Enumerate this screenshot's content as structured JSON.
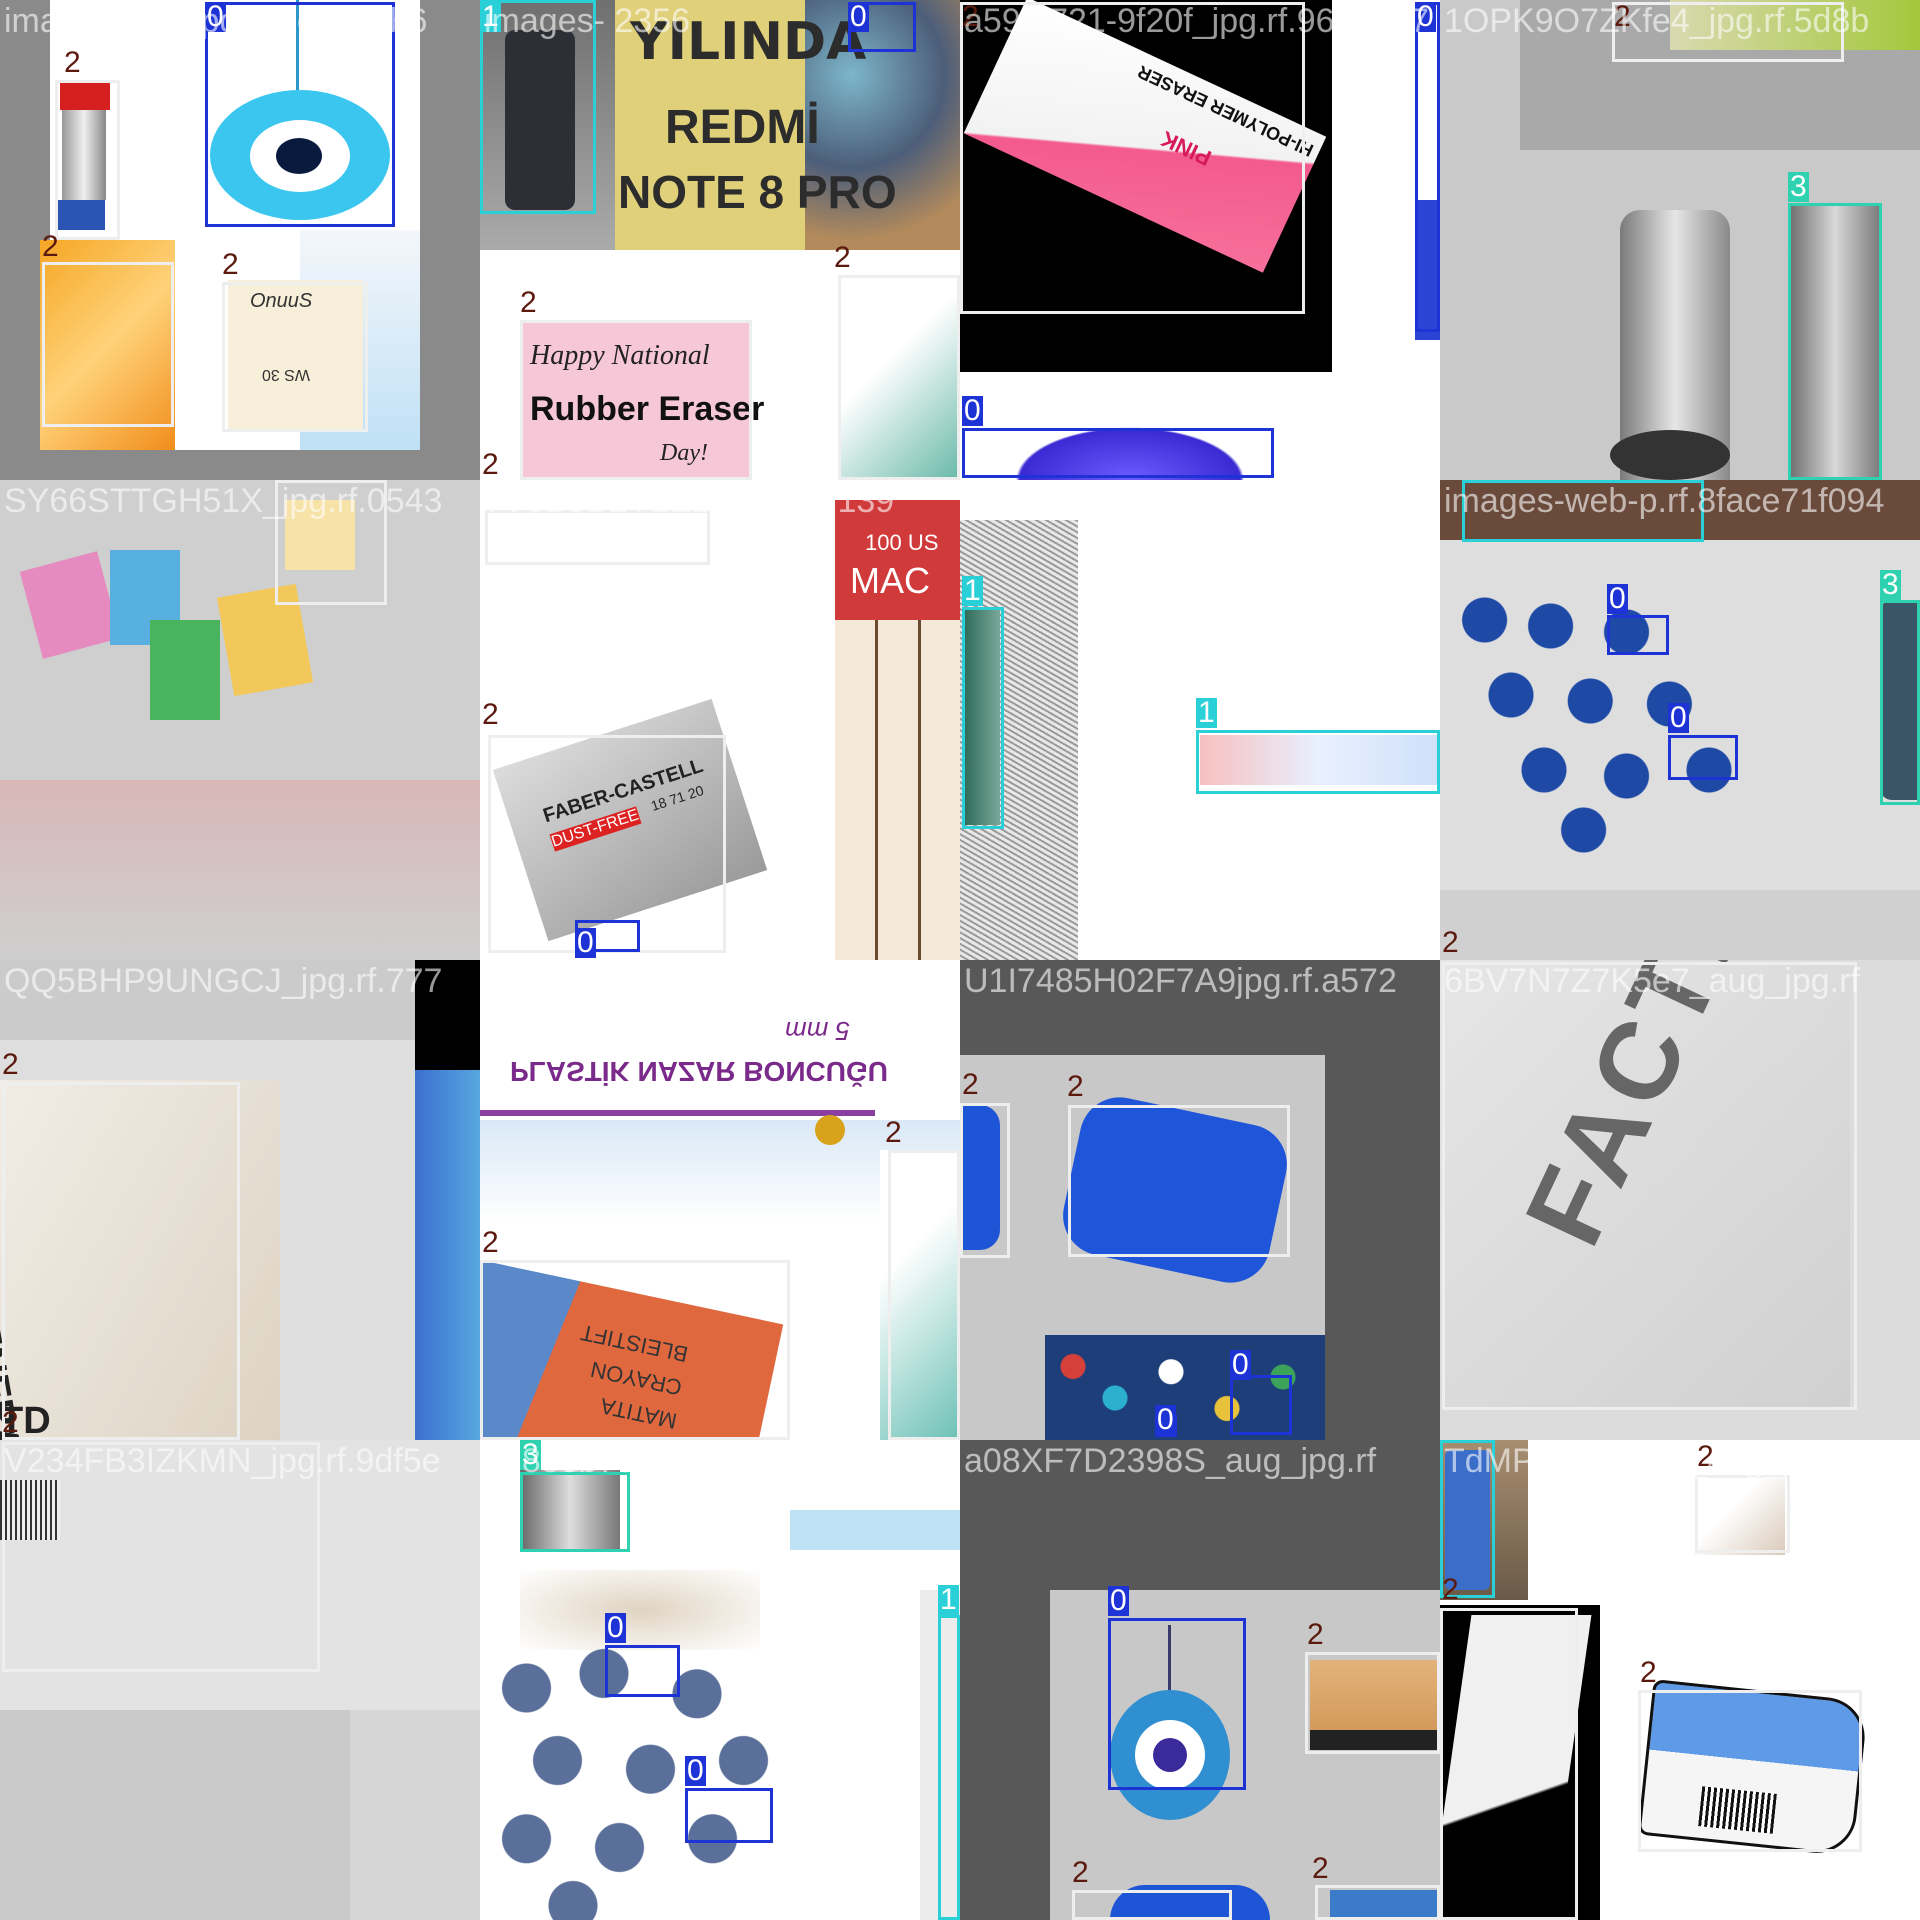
{
  "grid": {
    "tiles": [
      {
        "filename": "images-13-_jpg.rf.6ceb44b6",
        "boxes": [
          {
            "cls": "0",
            "label": "0"
          },
          {
            "cls": "2",
            "label": "2"
          },
          {
            "cls": "2",
            "label": "2"
          },
          {
            "cls": "2",
            "label": "2"
          }
        ],
        "texts": [
          "OnuuS",
          "WS 30"
        ]
      },
      {
        "filename": "images-  2356",
        "boxes": [
          {
            "cls": "1",
            "label": "1"
          },
          {
            "cls": "0",
            "label": "0"
          },
          {
            "cls": "2",
            "label": "2"
          },
          {
            "cls": "2",
            "label": "2"
          },
          {
            "cls": "2",
            "label": "2"
          }
        ],
        "texts": [
          "YILINDA",
          "REDMİ",
          "NOTE 8 PRO",
          "Happy National",
          "Rubber Eraser",
          "Day!"
        ]
      },
      {
        "filename": "a59 1721-9f20f_jpg.rf.96a0987",
        "boxes": [
          {
            "cls": "2",
            "label": "2"
          },
          {
            "cls": "0",
            "label": "0"
          },
          {
            "cls": "0",
            "label": "0"
          }
        ],
        "texts": [
          "PINK",
          "HI-POLYMER ERASER"
        ]
      },
      {
        "filename": "1OPK9O7ZKfe4_jpg.rf.5d8b",
        "boxes": [
          {
            "cls": "2",
            "label": "2"
          },
          {
            "cls": "3",
            "label": "3"
          }
        ],
        "texts": []
      },
      {
        "filename": "SY66STTGH51X_jpg.rf.0543",
        "boxes": [
          {
            "cls": "2",
            "label": "2"
          },
          {
            "cls": "2",
            "label": "2"
          }
        ],
        "texts": []
      },
      {
        "filename": "7V5B3B2Y1EB1_jpg.rf.139",
        "boxes": [
          {
            "cls": "2",
            "label": "2"
          },
          {
            "cls": "0",
            "label": "0"
          }
        ],
        "texts": [
          "100 US",
          "MAC",
          "FABER-CASTELL",
          "DUST-FREE",
          "18 71 20"
        ]
      },
      {
        "filename": "e30c13e-pasa-celik-t",
        "boxes": [
          {
            "cls": "1",
            "label": "1"
          },
          {
            "cls": "1",
            "label": "1"
          }
        ],
        "texts": []
      },
      {
        "filename": "images-web-p.rf.8face71f094",
        "boxes": [
          {
            "cls": "1",
            "label": "1"
          },
          {
            "cls": "0",
            "label": "0"
          },
          {
            "cls": "0",
            "label": "0"
          },
          {
            "cls": "3",
            "label": "3"
          },
          {
            "cls": "2",
            "label": "2"
          }
        ],
        "texts": []
      },
      {
        "filename": "QQ5BHP9UNGCJ_jpg.rf.777",
        "boxes": [
          {
            "cls": "2",
            "label": "2"
          },
          {
            "cls": "2",
            "label": "2"
          }
        ],
        "texts": [
          "GENERA",
          "TD"
        ]
      },
      {
        "filename": "dY5Ba8dd2d5_jpg.rf.a5c",
        "boxes": [
          {
            "cls": "2",
            "label": "2"
          },
          {
            "cls": "2",
            "label": "2"
          },
          {
            "cls": "3",
            "label": "3"
          }
        ],
        "texts": [
          "5 mm",
          "PLASTİK NAZAR BONCUĞU",
          "BLEISTIFT",
          "CRAYON",
          "MATITA"
        ]
      },
      {
        "filename": "U1I7485H02F7A9jpg.rf.a572",
        "boxes": [
          {
            "cls": "2",
            "label": "2"
          },
          {
            "cls": "2",
            "label": "2"
          },
          {
            "cls": "0",
            "label": "0"
          },
          {
            "cls": "0",
            "label": "0"
          }
        ],
        "texts": []
      },
      {
        "filename": "6BV7N7Z7K5e7_aug_jpg.rf",
        "boxes": [
          {
            "cls": "2",
            "label": "2"
          }
        ],
        "texts": [
          "FACTIS"
        ]
      },
      {
        "filename": "V234FB3IZKMN_jpg.rf.9df5e",
        "boxes": [
          {
            "cls": "2",
            "label": "2"
          }
        ],
        "texts": []
      },
      {
        "filename": "e2836b78547c_jpg.rf.e8f34",
        "boxes": [
          {
            "cls": "3",
            "label": "3"
          },
          {
            "cls": "0",
            "label": "0"
          },
          {
            "cls": "0",
            "label": "0"
          },
          {
            "cls": "1",
            "label": "1"
          }
        ],
        "texts": []
      },
      {
        "filename": "a08XF7D2398S_aug_jpg.rf",
        "boxes": [
          {
            "cls": "0",
            "label": "0"
          },
          {
            "cls": "2",
            "label": "2"
          },
          {
            "cls": "2",
            "label": "2"
          },
          {
            "cls": "2",
            "label": "2"
          }
        ],
        "texts": []
      },
      {
        "filename": "TdMPTUMB595_aug_jpg.rf",
        "boxes": [
          {
            "cls": "1",
            "label": "1"
          },
          {
            "cls": "2",
            "label": "2"
          },
          {
            "cls": "2",
            "label": "2"
          },
          {
            "cls": "2",
            "label": "2"
          }
        ],
        "texts": []
      }
    ]
  },
  "colors": {
    "class_0": "#1d33d6",
    "class_1": "#2ad0d8",
    "class_2": "#eeeeee",
    "class_3": "#2fd2b0",
    "label_2_text": "#5c1a0e"
  }
}
